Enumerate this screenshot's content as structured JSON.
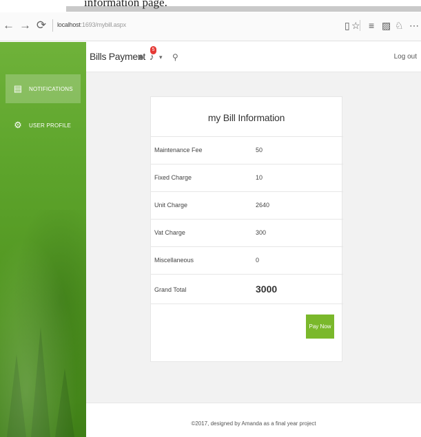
{
  "caption": {
    "text": "information page."
  },
  "browser": {
    "back": "←",
    "forward": "→",
    "refresh": "⟳",
    "url_host": "localhost",
    "url_rest": ":1693/mybill.aspx",
    "icons": [
      "reader-icon",
      "star-icon",
      "menu-icon",
      "note-icon",
      "share-icon",
      "more-icon"
    ]
  },
  "sidebar": {
    "items": [
      {
        "label": "NOTIFICATIONS",
        "icon": "clipboard-icon",
        "active": true
      },
      {
        "label": "USER PROFILE",
        "icon": "gear-icon",
        "active": false
      }
    ]
  },
  "header": {
    "brand": "Bills Payment",
    "notification_count": "5",
    "logout": "Log out"
  },
  "bill": {
    "title": "my Bill Information",
    "rows": [
      {
        "label": "Maintenance Fee",
        "value": "50"
      },
      {
        "label": "Fixed Charge",
        "value": "10"
      },
      {
        "label": "Unit Charge",
        "value": "2640"
      },
      {
        "label": "Vat Charge",
        "value": "300"
      },
      {
        "label": "Miscellaneous",
        "value": "0"
      }
    ],
    "total_label": "Grand Total",
    "total_value": "3000",
    "pay_button": "Pay Now"
  },
  "footer": {
    "text": "©2017, designed by Amanda as a final year project"
  },
  "colors": {
    "accent": "#7ab82b",
    "sidebar": "#5ea52c",
    "badge": "#e53935"
  }
}
